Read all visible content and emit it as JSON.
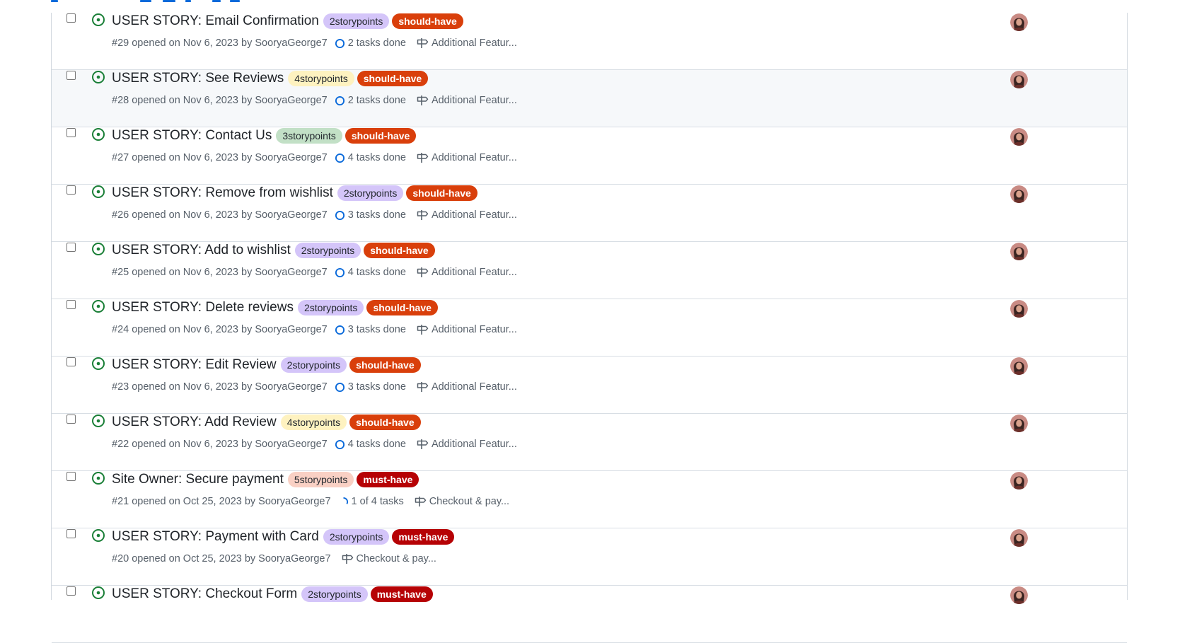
{
  "colors": {
    "open_icon": "#1a7f37",
    "story_label_bg": {
      "2storypoints": "#d4c5f9",
      "3storypoints": "#c2e0c6",
      "4storypoints": "#fef2c0",
      "5storypoints": "#f9d0c4"
    },
    "priority_label_bg": {
      "should-have": "#d93f0b",
      "must-have": "#b60205"
    }
  },
  "issues": [
    {
      "title": "USER STORY: Email Confirmation",
      "story_label": "2storypoints",
      "priority_label": "should-have",
      "number_text": "#29 opened on Nov 6, 2023 by",
      "author": "SooryaGeorge7",
      "tasks": "2 tasks done",
      "tasks_state": "open",
      "milestone": "Additional Featur..."
    },
    {
      "title": "USER STORY: See Reviews",
      "story_label": "4storypoints",
      "priority_label": "should-have",
      "number_text": "#28 opened on Nov 6, 2023 by",
      "author": "SooryaGeorge7",
      "tasks": "2 tasks done",
      "tasks_state": "open",
      "milestone": "Additional Featur..."
    },
    {
      "title": "USER STORY: Contact Us",
      "story_label": "3storypoints",
      "priority_label": "should-have",
      "number_text": "#27 opened on Nov 6, 2023 by",
      "author": "SooryaGeorge7",
      "tasks": "4 tasks done",
      "tasks_state": "open",
      "milestone": "Additional Featur..."
    },
    {
      "title": "USER STORY: Remove from wishlist",
      "story_label": "2storypoints",
      "priority_label": "should-have",
      "number_text": "#26 opened on Nov 6, 2023 by",
      "author": "SooryaGeorge7",
      "tasks": "3 tasks done",
      "tasks_state": "open",
      "milestone": "Additional Featur..."
    },
    {
      "title": "USER STORY: Add to wishlist",
      "story_label": "2storypoints",
      "priority_label": "should-have",
      "number_text": "#25 opened on Nov 6, 2023 by",
      "author": "SooryaGeorge7",
      "tasks": "4 tasks done",
      "tasks_state": "open",
      "milestone": "Additional Featur..."
    },
    {
      "title": "USER STORY: Delete reviews",
      "story_label": "2storypoints",
      "priority_label": "should-have",
      "number_text": "#24 opened on Nov 6, 2023 by",
      "author": "SooryaGeorge7",
      "tasks": "3 tasks done",
      "tasks_state": "open",
      "milestone": "Additional Featur..."
    },
    {
      "title": "USER STORY: Edit Review",
      "story_label": "2storypoints",
      "priority_label": "should-have",
      "number_text": "#23 opened on Nov 6, 2023 by",
      "author": "SooryaGeorge7",
      "tasks": "3 tasks done",
      "tasks_state": "open",
      "milestone": "Additional Featur..."
    },
    {
      "title": "USER STORY: Add Review",
      "story_label": "4storypoints",
      "priority_label": "should-have",
      "number_text": "#22 opened on Nov 6, 2023 by",
      "author": "SooryaGeorge7",
      "tasks": "4 tasks done",
      "tasks_state": "open",
      "milestone": "Additional Featur..."
    },
    {
      "title": "Site Owner: Secure payment",
      "story_label": "5storypoints",
      "priority_label": "must-have",
      "number_text": "#21 opened on Oct 25, 2023 by",
      "author": "SooryaGeorge7",
      "tasks": "1 of 4 tasks",
      "tasks_state": "partial",
      "milestone": "Checkout & pay..."
    },
    {
      "title": "USER STORY: Payment with Card",
      "story_label": "2storypoints",
      "priority_label": "must-have",
      "number_text": "#20 opened on Oct 25, 2023 by",
      "author": "SooryaGeorge7",
      "tasks": "",
      "tasks_state": "none",
      "milestone": "Checkout & pay..."
    },
    {
      "title": "USER STORY: Checkout Form",
      "story_label": "2storypoints",
      "priority_label": "must-have",
      "number_text": "",
      "author": "",
      "tasks": "",
      "tasks_state": "none",
      "milestone": ""
    }
  ]
}
